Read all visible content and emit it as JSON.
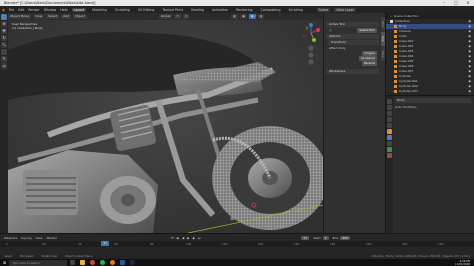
{
  "window": {
    "title": "Blender* [C:\\Users\\Mark\\Documents\\Bikes\\bike.blend]"
  },
  "menu": {
    "items": [
      "File",
      "Edit",
      "Render",
      "Window",
      "Help"
    ],
    "workspaces": [
      "Layout",
      "Modeling",
      "Sculpting",
      "UV Editing",
      "Texture Paint",
      "Shading",
      "Animation",
      "Rendering",
      "Compositing",
      "Scripting"
    ],
    "active_workspace": "Layout",
    "scene_label": "Scene",
    "view_layer_label": "View Layer"
  },
  "viewport_header": {
    "mode": "Object Mode",
    "view": "View",
    "select": "Select",
    "add": "Add",
    "object": "Object",
    "transform": "Global",
    "info_line1": "User Perspective",
    "info_line2": "(1) Collection | Body"
  },
  "npanel": {
    "tabs": [
      "Item",
      "Tool",
      "View"
    ],
    "active_tool_header": "Active Tool",
    "tool_name": "Select Box",
    "options_header": "Options",
    "transform_header": "Transform",
    "affect_only": "Affect Only",
    "origins": "Origins",
    "locations": "Locations",
    "parents": "Parents",
    "workspace_header": "Workspace"
  },
  "outliner": {
    "header": "Scene Collection",
    "items": [
      {
        "name": "Collection",
        "selected": false
      },
      {
        "name": "Body",
        "selected": true
      },
      {
        "name": "Camera",
        "selected": false
      },
      {
        "name": "Cube",
        "selected": false
      },
      {
        "name": "Cube.001",
        "selected": false
      },
      {
        "name": "Cube.002",
        "selected": false
      },
      {
        "name": "Cube.003",
        "selected": false
      },
      {
        "name": "Cube.004",
        "selected": false
      },
      {
        "name": "Cube.005",
        "selected": false
      },
      {
        "name": "Cube.006",
        "selected": false
      },
      {
        "name": "Cube.007",
        "selected": false
      },
      {
        "name": "Cylinder",
        "selected": false
      },
      {
        "name": "Cylinder.001",
        "selected": false
      },
      {
        "name": "Cylinder.002",
        "selected": false
      },
      {
        "name": "Cylinder.003",
        "selected": false
      }
    ]
  },
  "properties": {
    "object_name": "Body",
    "sub_label": "Auto Modifiers"
  },
  "timeline": {
    "menus": [
      "Playback",
      "Keying",
      "View",
      "Marker"
    ],
    "current_frame": "17",
    "start_label": "Start",
    "start": "1",
    "end_label": "End",
    "end": "250",
    "ruler": [
      "0",
      "20",
      "40",
      "60",
      "80",
      "100",
      "120",
      "140",
      "160",
      "180",
      "200",
      "220",
      "240"
    ]
  },
  "status": {
    "left": "Select",
    "mid": "Box Select",
    "right": "Rotate View",
    "right2": "Object Context Menu",
    "stats": "Collection | Body | Verts:1,286,494 | Faces:1,258,006 | Objects:1/77 | 2.90.1"
  },
  "taskbar": {
    "search_placeholder": "Type here to search",
    "time": "4:28 PM",
    "date": "11/01/2020"
  },
  "colors": {
    "accent": "#4772b3",
    "object_orange": "#e08e3c",
    "axis_x": "#d2424b",
    "axis_y": "#86b832",
    "axis_z": "#3e7ad6"
  }
}
